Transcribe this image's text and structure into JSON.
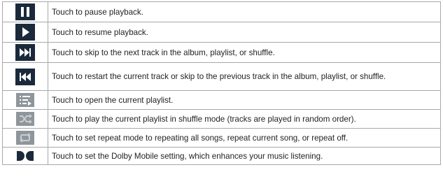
{
  "rows": [
    {
      "icon": "pause-icon",
      "text": "Touch to pause playback."
    },
    {
      "icon": "play-icon",
      "text": "Touch to resume playback."
    },
    {
      "icon": "fast-forward-icon",
      "text": "Touch to skip to the next track in the album, playlist, or shuffle."
    },
    {
      "icon": "rewind-icon",
      "text": "Touch to restart the current track or skip to the previous track in the album, playlist, or shuffle."
    },
    {
      "icon": "playlist-icon",
      "text": "Touch to open the current playlist."
    },
    {
      "icon": "shuffle-icon",
      "text": "Touch to play the current playlist in shuffle mode (tracks are played in random order)."
    },
    {
      "icon": "repeat-icon",
      "text": "Touch to set repeat mode to repeating all songs, repeat current song, or repeat off."
    },
    {
      "icon": "dolby-icon",
      "text": "Touch to set the Dolby Mobile setting, which enhances your music listening."
    }
  ],
  "colors": {
    "icon_dark": "#1a2a3a",
    "icon_grey": "#8e969c",
    "border": "#a8a8a8",
    "text": "#1f1f1f"
  }
}
